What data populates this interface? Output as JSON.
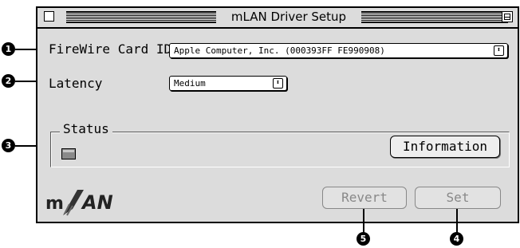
{
  "window": {
    "title": "mLAN Driver Setup"
  },
  "firewire": {
    "label": "FireWire Card ID",
    "value": "Apple Computer, Inc. (000393FF FE990908)"
  },
  "latency": {
    "label": "Latency",
    "value": "Medium"
  },
  "status": {
    "label": "Status"
  },
  "buttons": {
    "information": "Information",
    "revert": "Revert",
    "set": "Set"
  },
  "logo": {
    "text": "mLAN"
  },
  "callouts": [
    "1",
    "2",
    "3",
    "4",
    "5"
  ]
}
